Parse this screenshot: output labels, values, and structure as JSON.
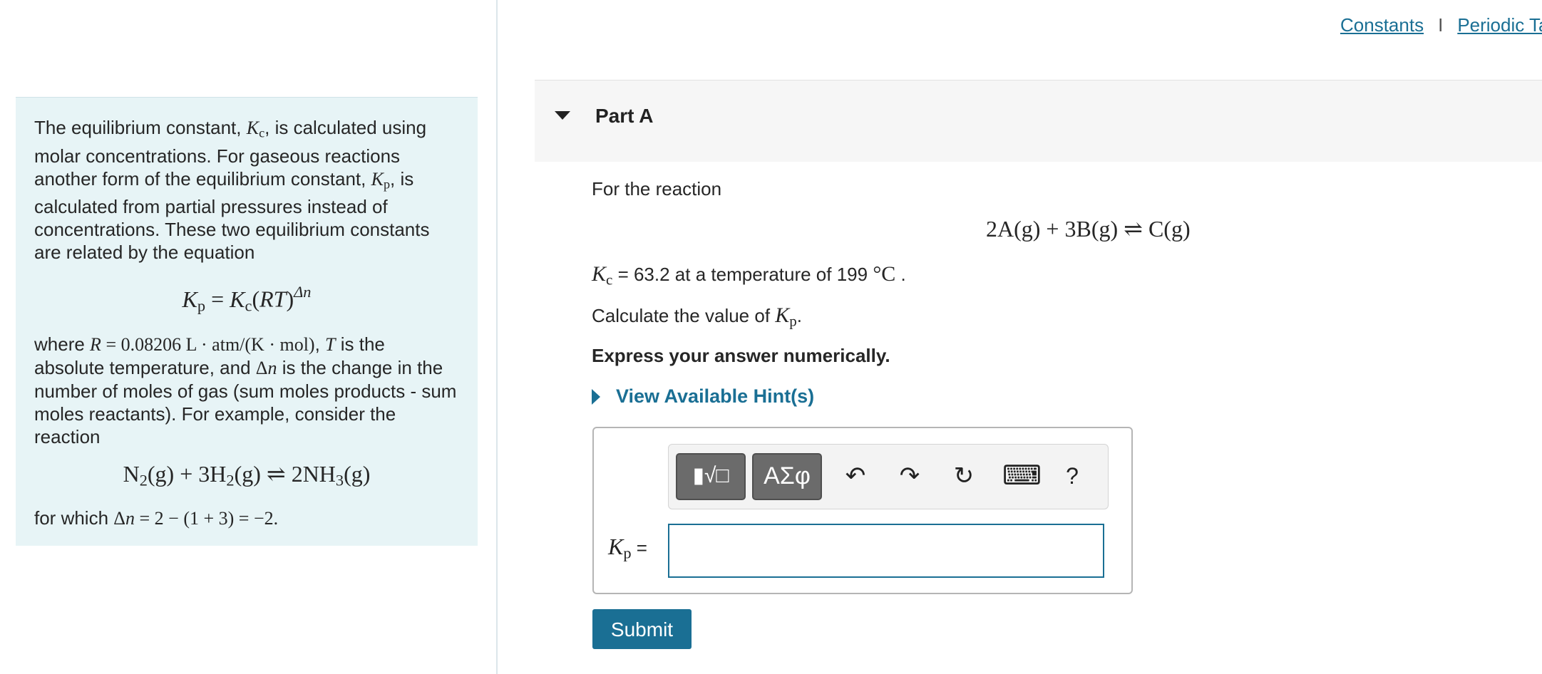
{
  "top_links": {
    "constants": "Constants",
    "separator": "I",
    "periodic_table": "Periodic Ta"
  },
  "intro": {
    "p1_a": "The equilibrium constant, ",
    "p1_b": ", is calculated using molar concentrations. For gaseous reactions another form of the equilibrium constant, ",
    "p1_c": ", is calculated from partial pressures instead of concentrations. These two equilibrium constants are related by the equation",
    "equation_kp_kc": "Kp = Kc(RT)^Δn",
    "p2_a": "where ",
    "p2_R": "R = 0.08206 L · atm/(K · mol)",
    "p2_b": ", ",
    "p2_T": "T",
    "p2_c": " is the absolute temperature, and ",
    "p2_dn": "Δn",
    "p2_d": " is the change in the number of moles of gas (sum moles products - sum moles reactants). For example, consider the reaction",
    "example_reaction": "N2(g) + 3H2(g) ⇌ 2NH3(g)",
    "p3_a": "for which ",
    "p3_eq": "Δn = 2 − (1 + 3) = −2."
  },
  "part": {
    "title": "Part A"
  },
  "problem": {
    "for_reaction": "For the reaction",
    "reaction": "2A(g) + 3B(g) ⇌ C(g)",
    "kc_text_a": " = 63.2 at a temperature of 199 ",
    "kc_unit": "°C",
    "kc_text_b": " .",
    "calc_a": "Calculate the value of ",
    "calc_b": ".",
    "express": "Express your answer numerically.",
    "hint": "View Available Hint(s)"
  },
  "answer": {
    "label_suffix": " =",
    "input_value": "",
    "toolbar": {
      "templates": "▮√□",
      "symbols": "ΑΣφ",
      "undo": "↶",
      "redo": "↷",
      "reset": "↻",
      "keyboard": "⌨",
      "help": "?"
    }
  },
  "submit_label": "Submit"
}
